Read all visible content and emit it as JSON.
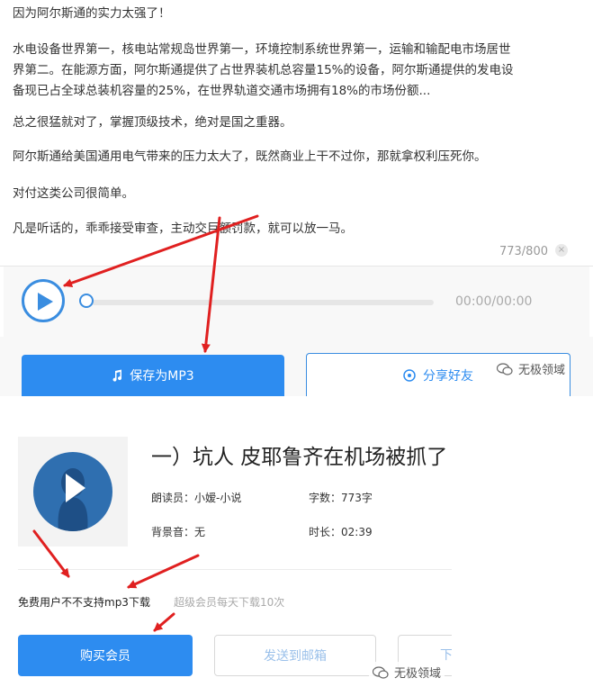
{
  "editor": {
    "paragraphs": [
      "因为阿尔斯通的实力太强了！",
      "水电设备世界第一，核电站常规岛世界第一，环境控制系统世界第一，运输和输配电市场居世",
      "界第二。在能源方面，阿尔斯通提供了占世界装机总容量15%的设备，阿尔斯通提供的发电设",
      "备现已占全球总装机容量的25%，在世界轨道交通市场拥有18%的市场份额...",
      "总之很猛就对了，掌握顶级技术，绝对是国之重器。",
      "阿尔斯通给美国通用电气带来的压力太大了，既然商业上干不过你，那就拿权利压死你。",
      "对付这类公司很简单。",
      "凡是听话的，乖乖接受审查，主动交巨额罚款，就可以放一马。"
    ],
    "char_count": "773/800",
    "clear_icon": "×"
  },
  "player": {
    "time": "00:00/00:00",
    "progress": 0
  },
  "actions": {
    "save_mp3": "保存为MP3",
    "share": "分享好友"
  },
  "watermark": {
    "label": "无极领域"
  },
  "book": {
    "title": "一）坑人 皮耶鲁齐在机场被抓了",
    "reader": "朗读员：小嫒-小说",
    "word_count": "字数：773字",
    "bgm": "背景音：无",
    "duration": "时长：02:39",
    "free_note": "免费用户不不支持mp3下载",
    "vip_note": "超级会员每天下载10次",
    "buy_vip": "购买会员",
    "send_mail": "发送到邮箱",
    "third_button": "下"
  },
  "colors": {
    "accent": "#2d8cf0",
    "arrow": "#e02020"
  }
}
